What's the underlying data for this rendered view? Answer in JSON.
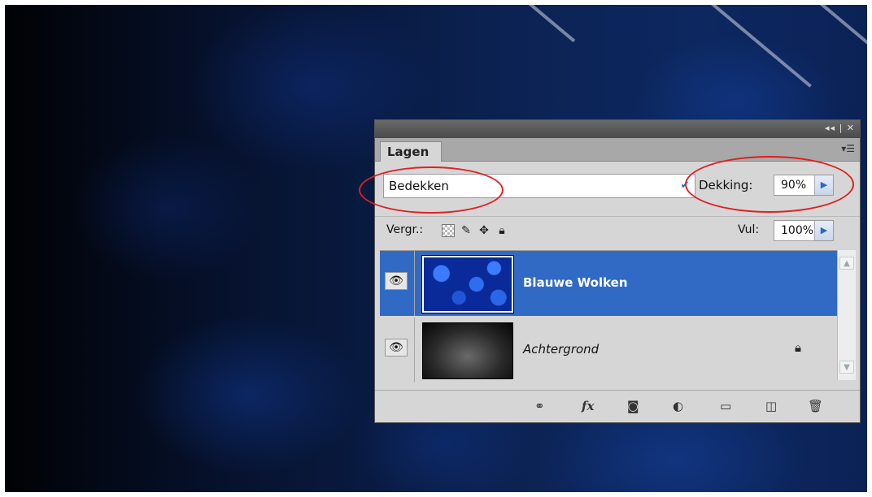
{
  "panel": {
    "window_controls": "◂◂ | ✕",
    "tab_label": "Lagen",
    "menu_icon": "panel-menu-icon",
    "blend_mode": "Bedekken",
    "opacity_label": "Dekking:",
    "opacity_value": "90%",
    "lock_label": "Vergr.:",
    "fill_label": "Vul:",
    "fill_value": "100%",
    "layers": [
      {
        "name": "Blauwe Wolken",
        "selected": true,
        "visible": true,
        "locked": false
      },
      {
        "name": "Achtergrond",
        "selected": false,
        "visible": true,
        "locked": true
      }
    ],
    "bottom_icons": [
      "link-layers-icon",
      "fx-icon",
      "add-mask-icon",
      "adjustment-layer-icon",
      "new-group-icon",
      "new-layer-icon",
      "trash-icon"
    ]
  },
  "colors": {
    "selection": "#316ac5",
    "annotation": "#e02020",
    "canvas_dark": "#0b2150"
  }
}
